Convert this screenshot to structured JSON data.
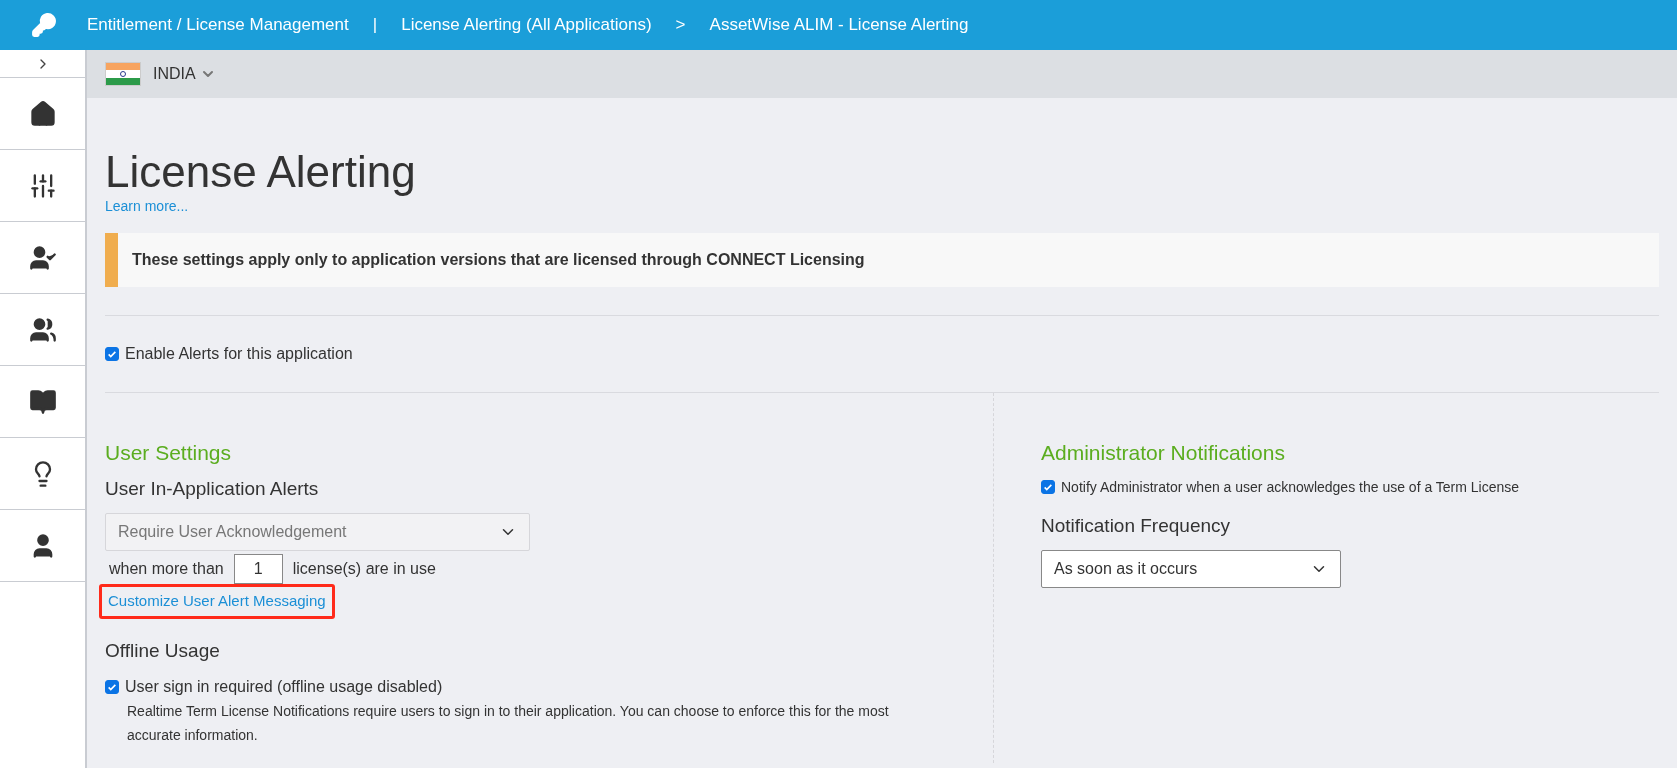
{
  "breadcrumb": [
    {
      "label": "Entitlement / License Management",
      "separator": "|"
    },
    {
      "label": "License Alerting (All Applications)",
      "separator": ">"
    },
    {
      "label": "AssetWise ALIM - License Alerting"
    }
  ],
  "region": {
    "label": "INDIA"
  },
  "page": {
    "title": "License Alerting",
    "learn_more": "Learn more...",
    "notice": "These settings apply only to application versions that are licensed through CONNECT Licensing"
  },
  "enable_alerts": {
    "label": "Enable Alerts for this application",
    "checked": true
  },
  "user_settings": {
    "heading": "User Settings",
    "subheading": "User In-Application Alerts",
    "alert_select": {
      "value": "Require User Acknowledgement",
      "disabled": true
    },
    "threshold_prefix": "when more than",
    "threshold_value": "1",
    "threshold_suffix": "license(s) are in use",
    "customize_link": {
      "label": "Customize User Alert Messaging",
      "highlighted": true
    },
    "offline_heading": "Offline Usage",
    "sign_in": {
      "label": "User sign in required (offline usage disabled)",
      "checked": true,
      "description": "Realtime Term License Notifications require users to sign in to their application. You can choose to enforce this for the most accurate information."
    }
  },
  "admin_notifications": {
    "heading": "Administrator Notifications",
    "notify": {
      "label": "Notify Administrator when a user acknowledges the use of a Term License",
      "checked": true
    },
    "frequency_heading": "Notification Frequency",
    "frequency_select": {
      "value": "As soon as it occurs",
      "disabled": false
    }
  }
}
